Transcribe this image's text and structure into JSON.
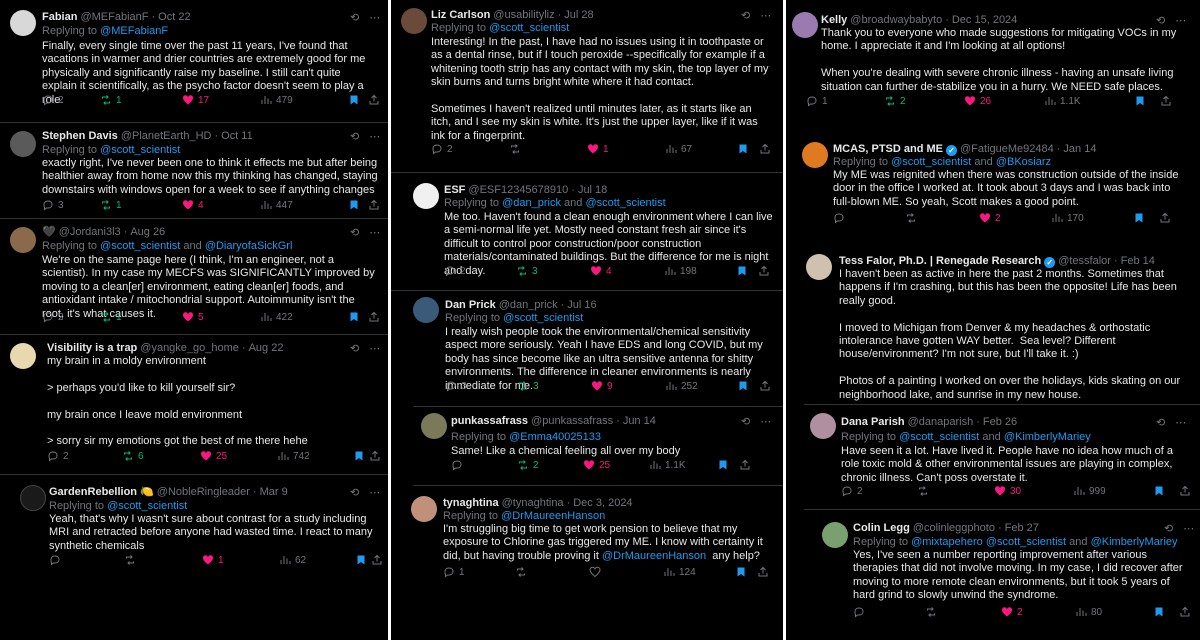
{
  "columns": [
    [
      {
        "name": "Fabian",
        "handle": "@MEFabianF",
        "date": "Oct 22",
        "replying_to": "@MEFabianF",
        "text": "Finally, every single time over the past 11 years, I've found that vacations in warmer and drier countries are extremely good for me physically and significantly raise my baseline. I still can't quite explain it scientifically, as the psycho factor doesn't seem to play a role.",
        "replies": "2",
        "reposts": "1",
        "likes": "17",
        "views": "479",
        "bookmarked": true
      },
      {
        "name": "Stephen Davis",
        "handle": "@PlanetEarth_HD",
        "date": "Oct 11",
        "replying_to": "@scott_scientist",
        "text": "exactly right, I've never been one to think it effects me but after being healthier away from home now this my thinking has changed, staying downstairs with windows open for a week to see if anything changes",
        "replies": "3",
        "reposts": "1",
        "likes": "4",
        "views": "447",
        "bookmarked": true
      },
      {
        "name": "🖤",
        "handle": "@Jordani3l3",
        "date": "Aug 26",
        "replying_to": "@scott_scientist and @DiaryofaSickGrl",
        "text": "We're on the same page here (I think, I'm an engineer, not a scientist). In my case my MECFS was SIGNIFICANTLY improved by moving to a clean[er] environment, eating clean[er] foods, and antioxidant intake / mitochondrial support. Autoimmunity isn't the root, it's what causes it.",
        "replies": "2",
        "reposts": "1",
        "likes": "5",
        "views": "422",
        "bookmarked": true
      },
      {
        "name": "Visibility is a trap",
        "handle": "@yangke_go_home",
        "date": "Aug 22",
        "replying_to": "",
        "text": "my brain in a moldy environment\n\n> perhaps you'd like to kill yourself sir?\n\nmy brain once I leave mold environment\n\n> sorry sir my emotions got the best of me there hehe",
        "replies": "2",
        "reposts": "6",
        "likes": "25",
        "views": "742",
        "bookmarked": true
      },
      {
        "name": "GardenRebellion 🍋",
        "handle": "@NobleRingleader",
        "date": "Mar 9",
        "replying_to": "@scott_scientist",
        "text": "Yeah, that's why I wasn't sure about contrast for a study including MRI and retracted before anyone had wasted time. I react to many synthetic chemicals",
        "replies": "",
        "reposts": "",
        "likes": "1",
        "views": "62",
        "bookmarked": true
      }
    ],
    [
      {
        "name": "Liz Carlson",
        "handle": "@usabilityliz",
        "date": "Jul 28",
        "replying_to": "@scott_scientist",
        "text": "Interesting! In the past, I have had no issues using it in toothpaste or as a dental rinse, but if I touch peroxide --specifically for example if a whitening tooth strip has any contact with my skin, the top layer of my skin burns and turns bright white where it had contact.\n\nSometimes I haven't realized until minutes later, as it starts like an itch, and I see my skin is white. It's just the upper layer, like if it was ink for a fingerprint.",
        "replies": "2",
        "reposts": "",
        "likes": "1",
        "views": "67",
        "bookmarked": true
      },
      {
        "name": "ESF",
        "handle": "@ESF12345678910",
        "date": "Jul 18",
        "replying_to": "@dan_prick and @scott_scientist",
        "text": "Me too. Haven't found a clean enough environment where I can live a semi-normal life yet. Mostly need constant fresh air since it's difficult to control poor construction/poor construction materials/contaminated buildings. But the difference for me is night and day.",
        "replies": "2",
        "reposts": "3",
        "likes": "4",
        "views": "198",
        "bookmarked": true
      },
      {
        "name": "Dan Prick",
        "handle": "@dan_prick",
        "date": "Jul 16",
        "replying_to": "@scott_scientist",
        "text": "I really wish people took the environmental/chemical sensitivity aspect more seriously. Yeah I have EDS and long COVID, but my body has since become like an ultra sensitive antenna for shitty environments. The difference in cleaner environments is nearly immediate for me.",
        "replies": "3",
        "reposts": "3",
        "likes": "9",
        "views": "252",
        "bookmarked": true
      },
      {
        "name": "punkassafrass",
        "handle": "@punkassafrass",
        "date": "Jun 14",
        "replying_to": "@Emma40025133",
        "text": "Same! Like a chemical feeling all over my body",
        "replies": "",
        "reposts": "2",
        "likes": "25",
        "views": "1.1K",
        "bookmarked": true
      },
      {
        "name": "tynaghtina",
        "handle": "@tynaghtina",
        "date": "Dec 3, 2024",
        "replying_to": "@DrMaureenHanson",
        "text": "I'm struggling big time to get work pension to believe that my exposure to Chlorine gas triggered my ME. I know with certainty it did, but having trouble proving it @DrMaureenHanson  any help?",
        "replies": "1",
        "reposts": "",
        "likes": "",
        "views": "124",
        "bookmarked": true
      }
    ],
    [
      {
        "name": "Kelly",
        "handle": "@broadwaybabyto",
        "date": "Dec 15, 2024",
        "replying_to": "",
        "text": "Thank you to everyone who made suggestions for mitigating VOCs in my home. I appreciate it and I'm looking at all options!\n\nWhen you're dealing with severe chronic illness - having an unsafe living situation can further de-stabilize you in a hurry. We NEED safe places.",
        "replies": "1",
        "reposts": "2",
        "likes": "26",
        "views": "1.1K",
        "bookmarked": true
      },
      {
        "name": "MCAS, PTSD and ME",
        "handle": "@FatigueMe92484",
        "date": "Jan 14",
        "replying_to": "@scott_scientist and @BKosiarz",
        "text": "My ME was reignited when there was construction outside of the inside door in the office I worked at. It took about 3 days and I was back into full-blown ME. So yeah, Scott makes a good point.",
        "replies": "",
        "reposts": "",
        "likes": "2",
        "views": "170",
        "bookmarked": true
      },
      {
        "name": "Tess Falor, Ph.D. | Renegade Research",
        "handle": "@tessfalor",
        "date": "Feb 14",
        "replying_to": "",
        "text": "I haven't been as active in here the past 2 months. Sometimes that happens if I'm crashing, but this has been the opposite! Life has been really good.\n\nI moved to Michigan from Denver & my headaches & orthostatic intolerance have gotten WAY better.  Sea level? Different house/environment? I'm not sure, but I'll take it. :)\n\nPhotos of a painting I worked on over the holidays, kids skating on our neighborhood lake, and sunrise in my new house.",
        "replies": "",
        "reposts": "",
        "likes": "",
        "views": "",
        "bookmarked": false
      },
      {
        "name": "Dana Parish",
        "handle": "@danaparish",
        "date": "Feb 26",
        "replying_to": "@scott_scientist and @KimberlyMariey",
        "text": "Have seen it a lot. Have lived it. People have no idea how much of a role toxic mold & other environmental issues are playing in complex, chronic illness. Can't poss overstate it.",
        "replies": "2",
        "reposts": "",
        "likes": "30",
        "views": "999",
        "bookmarked": true
      },
      {
        "name": "Colin Legg",
        "handle": "@colinleggphoto",
        "date": "Feb 27",
        "replying_to": "@mixtapehero @scott_scientist and @KimberlyMariey",
        "text": "Yes, I've seen a number reporting improvement after various therapies that did not involve moving. In my case, I did recover after moving to more remote clean environments, but it took 5 years of hard grind to slowly unwind the syndrome.",
        "replies": "",
        "reposts": "",
        "likes": "2",
        "views": "80",
        "bookmarked": true
      }
    ]
  ],
  "labels": {
    "replying_prefix": "Replying to "
  },
  "colors": {
    "background": "#000000",
    "text": "#e7e9ea",
    "muted": "#71767b",
    "link": "#1d9bf0",
    "repost": "#00ba7c",
    "like": "#f91880"
  }
}
